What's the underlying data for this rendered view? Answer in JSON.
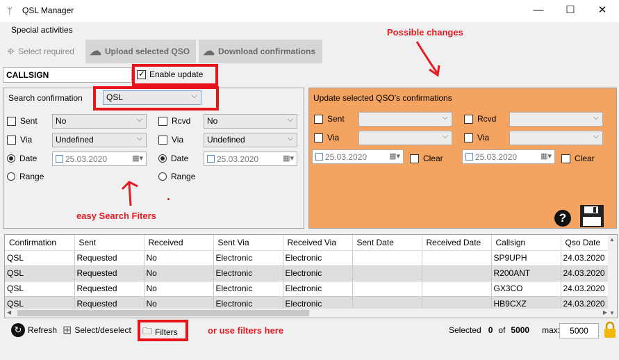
{
  "window": {
    "title": "QSL Manager",
    "minimize": "—",
    "maximize": "☐",
    "close": "✕"
  },
  "menu": {
    "special_activities": "Special activities"
  },
  "toolbar": {
    "select_required": "Select required",
    "upload_selected": "Upload selected QSO",
    "download_confirmations": "Download confirmations"
  },
  "callsign": {
    "value": "CALLSIGN"
  },
  "enable_update": {
    "label": "Enable update",
    "checked": true
  },
  "search": {
    "label": "Search confirmation",
    "value": "QSL",
    "sent_label": "Sent",
    "sent_value": "No",
    "via_label": "Via",
    "via_value": "Undefined",
    "date_label": "Date",
    "date_value": "25.03.2020",
    "range_label": "Range",
    "rcvd_label": "Rcvd",
    "rcvd_value": "No",
    "via2_label": "Via",
    "via2_value": "Undefined",
    "date2_label": "Date",
    "date2_value": "25.03.2020",
    "range2_label": "Range"
  },
  "update": {
    "title": "Update selected QSO's confirmations",
    "sent_label": "Sent",
    "rcvd_label": "Rcvd",
    "via_label": "Via",
    "via2_label": "Via",
    "date_value": "25.03.2020",
    "date2_value": "25.03.2020",
    "clear_label": "Clear",
    "clear2_label": "Clear"
  },
  "annotations": {
    "possible_changes": "Possible changes",
    "easy_filters": "easy Search Fiters",
    "use_filters": "or use filters here"
  },
  "table": {
    "columns": [
      "Confirmation",
      "Sent",
      "Received",
      "Sent Via",
      "Received Via",
      "Sent Date",
      "Received Date",
      "Callsign",
      "Qso Date"
    ],
    "rows": [
      [
        "QSL",
        "Requested",
        "No",
        "Electronic",
        "Electronic",
        "",
        "",
        "SP9UPH",
        "24.03.2020"
      ],
      [
        "QSL",
        "Requested",
        "No",
        "Electronic",
        "Electronic",
        "",
        "",
        "R200ANT",
        "24.03.2020"
      ],
      [
        "QSL",
        "Requested",
        "No",
        "Electronic",
        "Electronic",
        "",
        "",
        "GX3CO",
        "24.03.2020"
      ],
      [
        "QSL",
        "Requested",
        "No",
        "Electronic",
        "Electronic",
        "",
        "",
        "HB9CXZ",
        "24.03.2020"
      ]
    ]
  },
  "status": {
    "refresh": "Refresh",
    "select_deselect": "Select/deselect",
    "filters": "Filters",
    "selected_label": "Selected",
    "selected_count": "0",
    "of_label": "of",
    "total": "5000",
    "max_label": "max:",
    "max_value": "5000"
  },
  "icons": {
    "app": "antenna-icon",
    "target": "target-icon",
    "upload": "cloud-upload-icon",
    "download": "cloud-download-icon",
    "help": "help-icon",
    "save": "floppy-icon",
    "refresh": "refresh-icon",
    "select": "grid-icon",
    "filters": "folder-search-icon",
    "lock": "lock-icon"
  }
}
